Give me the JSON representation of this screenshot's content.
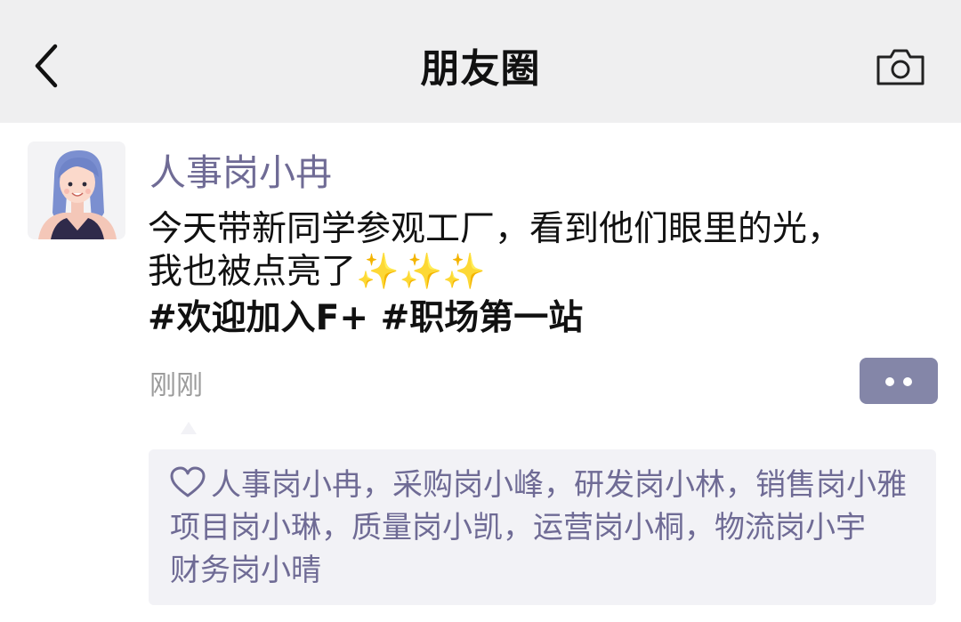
{
  "header": {
    "title": "朋友圈",
    "back_icon": "chevron-left-icon",
    "camera_icon": "camera-icon"
  },
  "post": {
    "author": "人事岗小冉",
    "avatar_icon": "woman-avatar",
    "text_line1": "今天带新同学参观工厂，看到他们眼里的光，",
    "text_line2": "我也被点亮了",
    "sparkles": "✨✨✨",
    "tags": "#欢迎加入F+ #职场第一站",
    "time": "刚刚",
    "more_icon": "more-dots-icon"
  },
  "likes": {
    "icon": "heart-outline-icon",
    "line1": "人事岗小冉，采购岗小峰，研发岗小林，销售岗小雅",
    "line2": "项目岗小琳，质量岗小凯，运营岗小桐，物流岗小宇",
    "line3": "财务岗小晴"
  },
  "colors": {
    "header_bg": "#efeff0",
    "name_color": "#6f6b95",
    "more_button_bg": "#8486a8",
    "likes_bg": "#f2f2f6"
  }
}
